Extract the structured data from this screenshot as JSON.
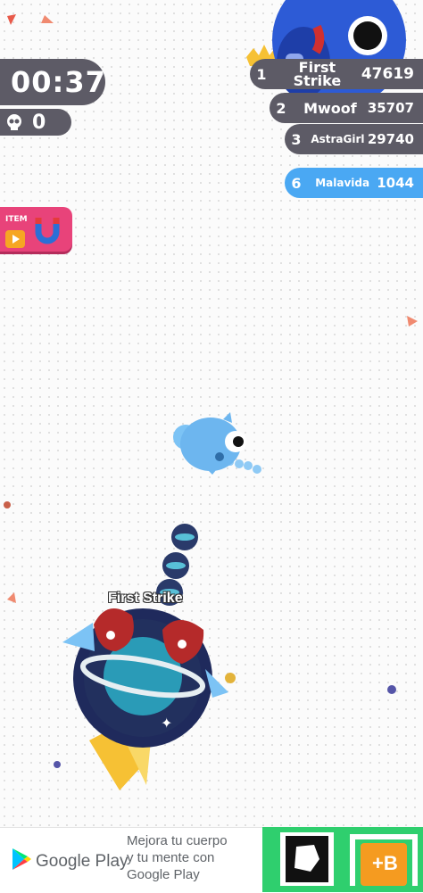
{
  "hud": {
    "timer": "00:37",
    "kills": "0",
    "item_label": "ITEM"
  },
  "leaderboard": [
    {
      "rank": "1",
      "name_line1": "First",
      "name_line2": "Strike",
      "score": "47619"
    },
    {
      "rank": "2",
      "name": "Mwoof",
      "score": "35707"
    },
    {
      "rank": "3",
      "name": "AstraGirl",
      "score": "29740"
    },
    {
      "rank": "6",
      "name": "Malavida",
      "score": "1044"
    }
  ],
  "player": {
    "nickname": "First Strike"
  },
  "ad": {
    "brand": "Google Play",
    "line1": "Mejora tu cuerpo",
    "line2": "y tu mente con",
    "line3": "Google Play",
    "app_badge": "+B"
  },
  "colors": {
    "hud_bg": "#5d5b66",
    "item_bg": "#e8437a",
    "own_rank_bg": "#4aa8f3",
    "player_blue": "#7cc3f5",
    "planet_teal": "#2a9bb7"
  }
}
